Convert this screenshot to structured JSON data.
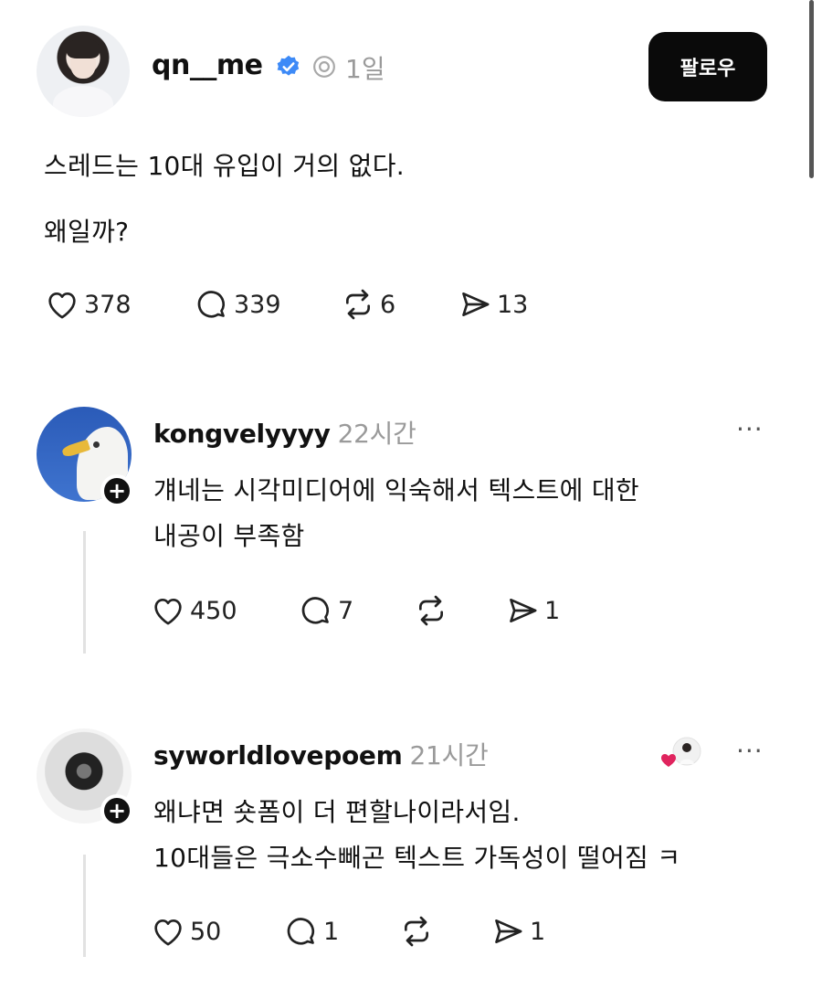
{
  "post": {
    "username": "qn__me",
    "time": "1일",
    "follow_label": "팔로우",
    "text_line1": "스레드는 10대 유입이 거의 없다.",
    "text_line2": "왜일까?",
    "likes": "378",
    "comments": "339",
    "reposts": "6",
    "shares": "13"
  },
  "replies": [
    {
      "username": "kongvelyyyy",
      "time": "22시간",
      "more": "···",
      "line1": "걔네는 시각미디어에 익숙해서 텍스트에 대한",
      "line2": "내공이 부족함",
      "likes": "450",
      "comments": "7",
      "shares": "1"
    },
    {
      "username": "syworldlovepoem",
      "time": "21시간",
      "more": "···",
      "line1": "왜냐면 숏폼이 더 편할나이라서임.",
      "line2": "10대들은 극소수빼곤 텍스트 가독성이 떨어짐 ㅋ",
      "likes": "50",
      "comments": "1",
      "shares": "1"
    }
  ],
  "icons": {
    "plus": "+"
  },
  "colors": {
    "verified_blue": "#3d8af7",
    "muted_gray": "#9a9a9a",
    "button_black": "#0a0a0a",
    "heart_red": "#e0245e"
  }
}
